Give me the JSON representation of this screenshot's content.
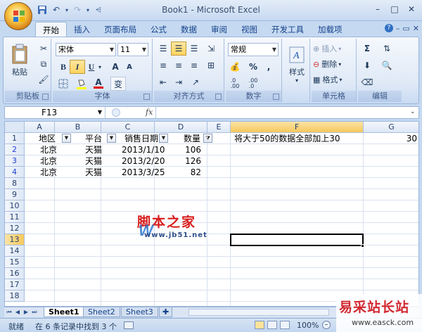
{
  "window": {
    "title": "Book1 - Microsoft Excel"
  },
  "qat": {
    "icons": [
      "save-icon",
      "undo-icon",
      "redo-icon",
      "customize-icon"
    ]
  },
  "tabs": [
    "开始",
    "插入",
    "页面布局",
    "公式",
    "数据",
    "审阅",
    "视图",
    "开发工具",
    "加载项"
  ],
  "active_tab": "开始",
  "ribbon": {
    "clipboard": {
      "label": "剪贴板",
      "paste": "粘贴"
    },
    "font": {
      "label": "字体",
      "font_name": "宋体",
      "font_size": "11",
      "bold": "B",
      "italic": "I",
      "underline": "U",
      "grow": "A",
      "shrink": "A",
      "color_a": "A",
      "phonetic": "变"
    },
    "alignment": {
      "label": "对齐方式"
    },
    "number": {
      "label": "数字",
      "format": "常规",
      "percent": "%",
      "comma": ","
    },
    "styles": {
      "label": "样式"
    },
    "cells": {
      "label": "单元格",
      "insert": "插入",
      "delete": "删除",
      "format": "格式"
    },
    "editing": {
      "label": "编辑"
    }
  },
  "formula_bar": {
    "name_box": "F13",
    "fx": "fx",
    "content": ""
  },
  "columns": [
    "A",
    "B",
    "C",
    "D",
    "E",
    "F",
    "G"
  ],
  "rows": [
    "1",
    "2",
    "3",
    "4",
    "8",
    "9",
    "10",
    "11",
    "12",
    "13",
    "14",
    "15",
    "16",
    "17",
    "18"
  ],
  "selected_cell": {
    "column": "F",
    "row": "13"
  },
  "cells": {
    "A1": "地区",
    "B1": "平台",
    "C1": "销售日期",
    "D1": "数量",
    "F1": "将大于50的数据全部加上30",
    "G1": "30",
    "A2": "北京",
    "B2": "天猫",
    "C2": "2013/1/10",
    "D2": "106",
    "A3": "北京",
    "B3": "天猫",
    "C3": "2013/2/20",
    "D3": "126",
    "A4": "北京",
    "B4": "天猫",
    "C4": "2013/3/25",
    "D4": "82"
  },
  "sheets": [
    "Sheet1",
    "Sheet2",
    "Sheet3"
  ],
  "active_sheet": "Sheet1",
  "status": {
    "mode": "就绪",
    "message": "在 6 条记录中找到 3 个",
    "zoom": "100%"
  },
  "watermarks": {
    "logo": "脚本之家",
    "logo_sub": "www.jb51.net",
    "corner": "易采站长站",
    "corner_url": "www.easck.com"
  }
}
